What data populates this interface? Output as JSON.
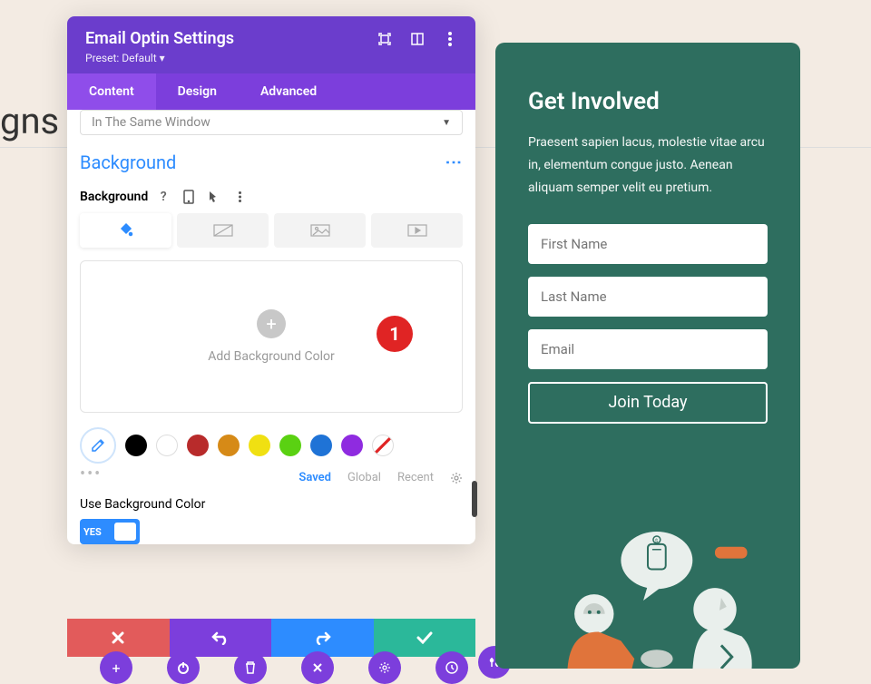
{
  "bg_text": "gns",
  "modal": {
    "title": "Email Optin Settings",
    "preset": "Preset: Default",
    "tabs": [
      "Content",
      "Design",
      "Advanced"
    ],
    "active_tab": 0,
    "select_value": "In The Same Window",
    "section_title": "Background",
    "field_label": "Background",
    "add_color_label": "Add Background Color",
    "swatch_labels": {
      "saved": "Saved",
      "global": "Global",
      "recent": "Recent"
    },
    "use_bg_label": "Use Background Color",
    "toggle_value": "YES"
  },
  "badge": "1",
  "swatches": [
    "#000000",
    "#ffffff",
    "#b82b2b",
    "#d68a17",
    "#f0e012",
    "#5ad112",
    "#1f73d6",
    "#8f2be0"
  ],
  "preview": {
    "title": "Get Involved",
    "text": "Praesent sapien lacus, molestie vitae arcu in, elementum congue justo. Aenean aliquam semper velit eu pretium.",
    "fields": {
      "first": "First Name",
      "last": "Last Name",
      "email": "Email"
    },
    "button": "Join Today"
  },
  "colors": {
    "accent_purple": "#7c3edc",
    "accent_blue": "#2d8cff",
    "accent_green": "#2bb89a",
    "accent_red": "#e25b5b",
    "badge_red": "#e02424",
    "preview_bg": "#2e6e5f"
  }
}
